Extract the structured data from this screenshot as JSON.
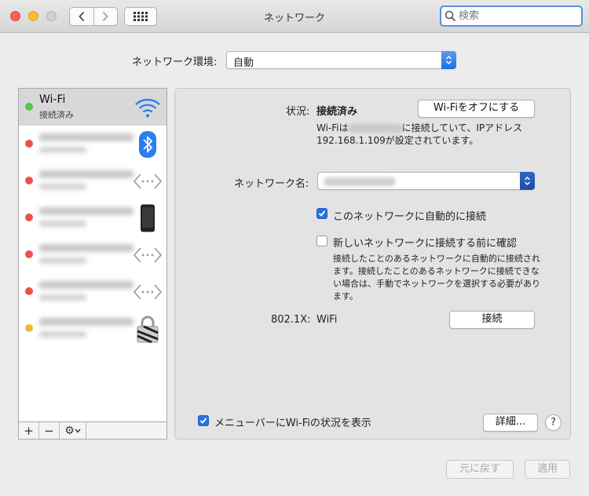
{
  "window": {
    "title": "ネットワーク"
  },
  "search": {
    "placeholder": "検索"
  },
  "location": {
    "label": "ネットワーク環境:",
    "value": "自動"
  },
  "services": [
    {
      "name": "Wi-Fi",
      "status": "接続済み",
      "status_color": "#58c24a",
      "icon": "wifi-icon",
      "selected": true
    },
    {
      "status_color": "#e8524a",
      "icon": "bluetooth-icon"
    },
    {
      "status_color": "#e8524a",
      "icon": "ethernet-icon"
    },
    {
      "status_color": "#e8524a",
      "icon": "iphone-icon"
    },
    {
      "status_color": "#e8524a",
      "icon": "ethernet-icon"
    },
    {
      "status_color": "#e8524a",
      "icon": "ethernet-icon"
    },
    {
      "status_color": "#f0b93a",
      "icon": "lock-icon"
    }
  ],
  "sidebar_toolbar": {
    "add": "+",
    "remove": "−",
    "gear": "⚙"
  },
  "detail": {
    "status_label": "状況:",
    "status_value": "接続済み",
    "wifi_off_button": "Wi-Fiをオフにする",
    "status_desc_prefix": "Wi-Fiは",
    "status_desc_suffix": "に接続していて、IPアドレス",
    "status_desc_line2": "192.168.1.109が設定されています。",
    "network_name_label": "ネットワーク名:",
    "auto_join_label": "このネットワークに自動的に接続",
    "auto_join_checked": true,
    "ask_join_label": "新しいネットワークに接続する前に確認",
    "ask_join_checked": false,
    "ask_join_desc_1": "接続したことのあるネットワークに自動的に接続され",
    "ask_join_desc_2": "ます。接続したことのあるネットワークに接続できな",
    "ask_join_desc_3": "い場合は、手動でネットワークを選択する必要があり",
    "ask_join_desc_4": "ます。",
    "dot1x_label": "802.1X:",
    "dot1x_value": "WiFi",
    "connect_button": "接続",
    "menubar_label": "メニューバーにWi-Fiの状況を表示",
    "menubar_checked": true,
    "advanced_button": "詳細...",
    "help": "?"
  },
  "footer": {
    "revert_button": "元に戻す",
    "apply_button": "適用"
  },
  "colors": {
    "accent": "#2b72e0",
    "selected_row": "#d8d8d8"
  }
}
